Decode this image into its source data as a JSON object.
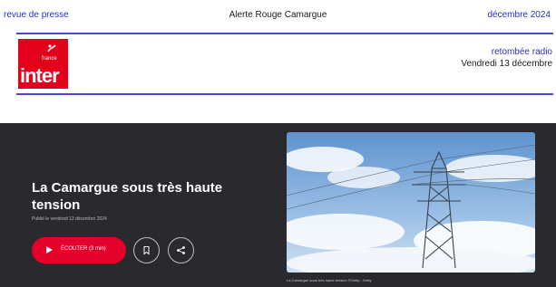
{
  "header": {
    "category": "revue de presse",
    "campaign": "Alerte Rouge Camargue",
    "month": "décembre 2024"
  },
  "media": {
    "logo_small_text": "france",
    "logo_text": "inter",
    "brand_color": "#e2001a",
    "type": "retombée radio",
    "date": "Vendredi 13 décembre"
  },
  "article": {
    "title": "La Camargue sous très haute tension",
    "published": "Publié le vendredi 13 décembre 2024",
    "listen_label": "ÉCOUTER (3 min)",
    "listen_color": "#e3012b",
    "photo_caption": "La Camargue sous très haute tension ©Getty - Getty"
  },
  "accent_color": "#2b2ec8"
}
